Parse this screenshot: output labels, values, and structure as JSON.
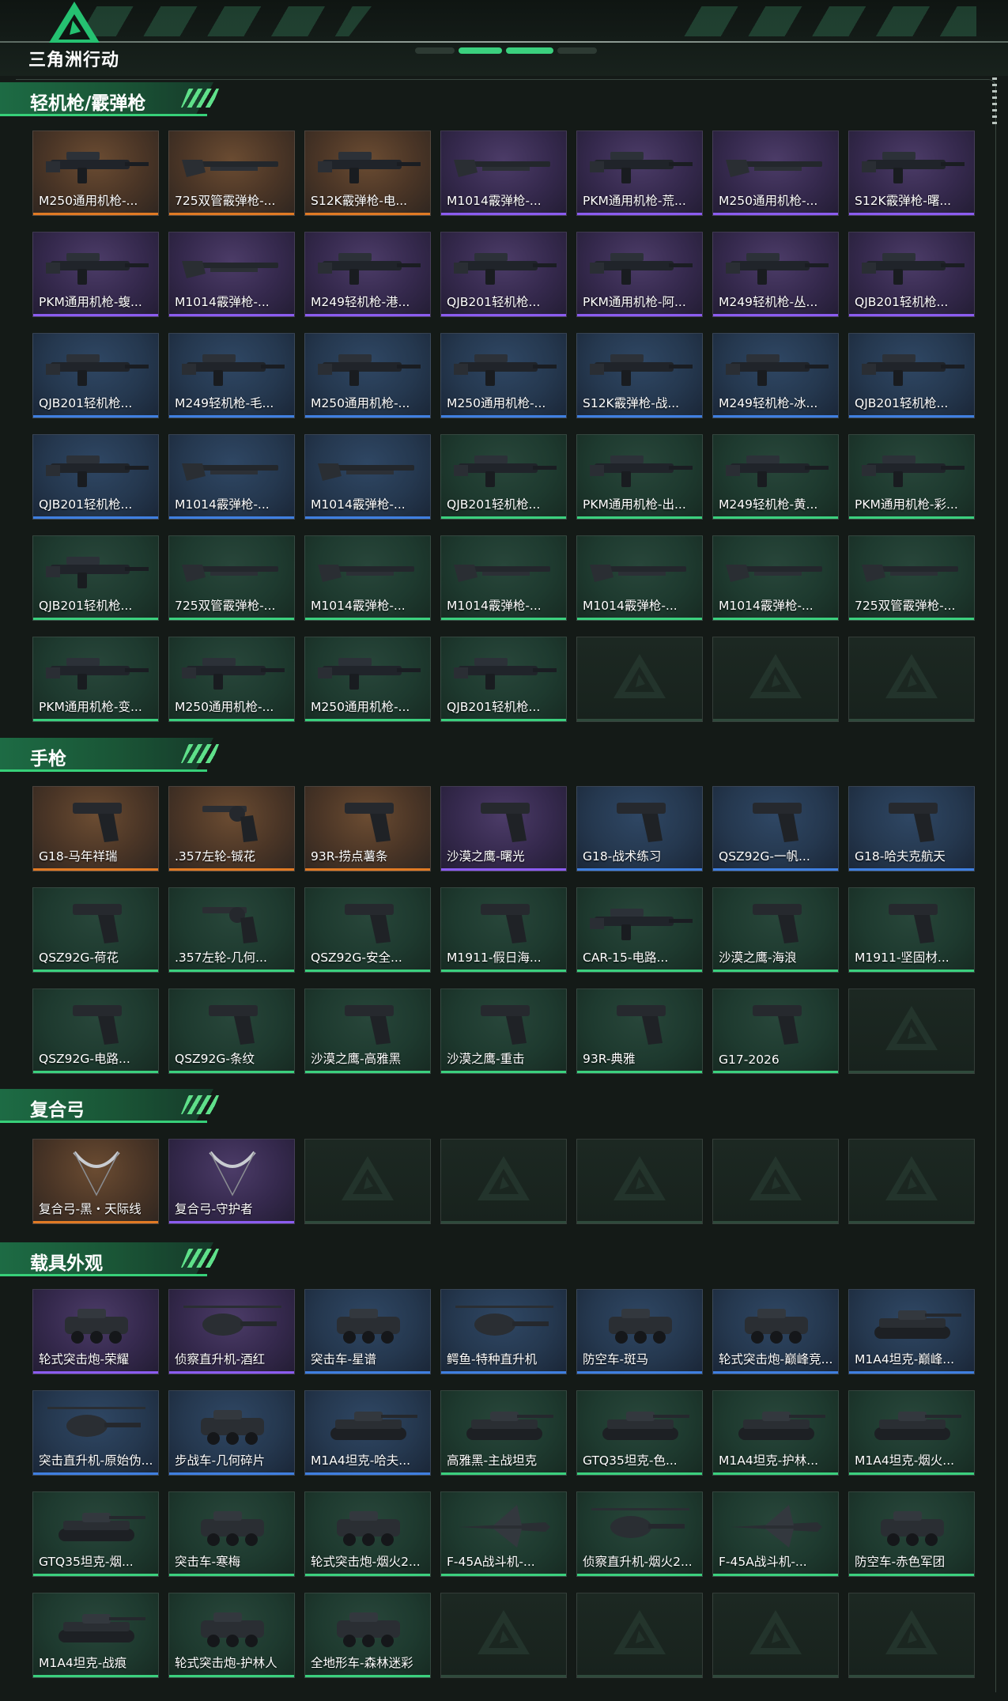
{
  "header": {
    "logo_text": "三角洲行动"
  },
  "colors": {
    "gold": "#e07a24",
    "purple": "#8b5cf0",
    "blue": "#3f7fe0",
    "green": "#3bd07e",
    "accent": "#37d079"
  },
  "sections": [
    {
      "title": "轻机枪/霰弹枪",
      "items": [
        {
          "label": "M250通用机枪-...",
          "q": "gold",
          "icon": "machine-gun"
        },
        {
          "label": "725双管霰弹枪-...",
          "q": "gold",
          "icon": "shotgun"
        },
        {
          "label": "S12K霰弹枪-电...",
          "q": "gold",
          "icon": "machine-gun"
        },
        {
          "label": "M1014霰弹枪-...",
          "q": "purple",
          "icon": "shotgun"
        },
        {
          "label": "PKM通用机枪-荒...",
          "q": "purple",
          "icon": "machine-gun"
        },
        {
          "label": "M250通用机枪-...",
          "q": "purple",
          "icon": "shotgun"
        },
        {
          "label": "S12K霰弹枪-曙...",
          "q": "purple",
          "icon": "machine-gun"
        },
        {
          "label": "PKM通用机枪-蝮...",
          "q": "purple",
          "icon": "machine-gun"
        },
        {
          "label": "M1014霰弹枪-...",
          "q": "purple",
          "icon": "shotgun"
        },
        {
          "label": "M249轻机枪-港...",
          "q": "purple",
          "icon": "machine-gun"
        },
        {
          "label": "QJB201轻机枪...",
          "q": "purple",
          "icon": "machine-gun"
        },
        {
          "label": "PKM通用机枪-阿...",
          "q": "purple",
          "icon": "machine-gun"
        },
        {
          "label": "M249轻机枪-丛...",
          "q": "purple",
          "icon": "machine-gun"
        },
        {
          "label": "QJB201轻机枪...",
          "q": "purple",
          "icon": "machine-gun"
        },
        {
          "label": "QJB201轻机枪...",
          "q": "blue",
          "icon": "machine-gun"
        },
        {
          "label": "M249轻机枪-毛...",
          "q": "blue",
          "icon": "machine-gun"
        },
        {
          "label": "M250通用机枪-...",
          "q": "blue",
          "icon": "machine-gun"
        },
        {
          "label": "M250通用机枪-...",
          "q": "blue",
          "icon": "machine-gun"
        },
        {
          "label": "S12K霰弹枪-战...",
          "q": "blue",
          "icon": "machine-gun"
        },
        {
          "label": "M249轻机枪-冰...",
          "q": "blue",
          "icon": "machine-gun"
        },
        {
          "label": "QJB201轻机枪...",
          "q": "blue",
          "icon": "machine-gun"
        },
        {
          "label": "QJB201轻机枪...",
          "q": "blue",
          "icon": "machine-gun"
        },
        {
          "label": "M1014霰弹枪-...",
          "q": "blue",
          "icon": "shotgun"
        },
        {
          "label": "M1014霰弹枪-...",
          "q": "blue",
          "icon": "shotgun"
        },
        {
          "label": "QJB201轻机枪...",
          "q": "green",
          "icon": "machine-gun"
        },
        {
          "label": "PKM通用机枪-出...",
          "q": "green",
          "icon": "machine-gun"
        },
        {
          "label": "M249轻机枪-黄...",
          "q": "green",
          "icon": "machine-gun"
        },
        {
          "label": "PKM通用机枪-彩...",
          "q": "green",
          "icon": "machine-gun"
        },
        {
          "label": "QJB201轻机枪...",
          "q": "green",
          "icon": "machine-gun"
        },
        {
          "label": "725双管霰弹枪-...",
          "q": "green",
          "icon": "shotgun"
        },
        {
          "label": "M1014霰弹枪-...",
          "q": "green",
          "icon": "shotgun"
        },
        {
          "label": "M1014霰弹枪-...",
          "q": "green",
          "icon": "shotgun"
        },
        {
          "label": "M1014霰弹枪-...",
          "q": "green",
          "icon": "shotgun"
        },
        {
          "label": "M1014霰弹枪-...",
          "q": "green",
          "icon": "shotgun"
        },
        {
          "label": "725双管霰弹枪-...",
          "q": "green",
          "icon": "shotgun"
        },
        {
          "label": "PKM通用机枪-变...",
          "q": "green",
          "icon": "machine-gun"
        },
        {
          "label": "M250通用机枪-...",
          "q": "green",
          "icon": "machine-gun"
        },
        {
          "label": "M250通用机枪-...",
          "q": "green",
          "icon": "machine-gun"
        },
        {
          "label": "QJB201轻机枪...",
          "q": "green",
          "icon": "machine-gun"
        },
        {
          "label": "",
          "q": "empty"
        },
        {
          "label": "",
          "q": "empty"
        },
        {
          "label": "",
          "q": "empty"
        }
      ]
    },
    {
      "title": "手枪",
      "items": [
        {
          "label": "G18-马年祥瑞",
          "q": "gold",
          "icon": "pistol"
        },
        {
          "label": ".357左轮-铖花",
          "q": "gold",
          "icon": "revolver"
        },
        {
          "label": "93R-捞点薯条",
          "q": "gold",
          "icon": "pistol"
        },
        {
          "label": "沙漠之鹰-曙光",
          "q": "purple",
          "icon": "pistol"
        },
        {
          "label": "G18-战术练习",
          "q": "blue",
          "icon": "pistol"
        },
        {
          "label": "QSZ92G-一帆...",
          "q": "blue",
          "icon": "pistol"
        },
        {
          "label": "G18-哈夫克航天",
          "q": "blue",
          "icon": "pistol"
        },
        {
          "label": "QSZ92G-荷花",
          "q": "green",
          "icon": "pistol"
        },
        {
          "label": ".357左轮-几何...",
          "q": "green",
          "icon": "revolver"
        },
        {
          "label": "QSZ92G-安全...",
          "q": "green",
          "icon": "pistol"
        },
        {
          "label": "M1911-假日海...",
          "q": "green",
          "icon": "pistol"
        },
        {
          "label": "CAR-15-电路...",
          "q": "green",
          "icon": "machine-gun"
        },
        {
          "label": "沙漠之鹰-海浪",
          "q": "green",
          "icon": "pistol"
        },
        {
          "label": "M1911-坚固材...",
          "q": "green",
          "icon": "pistol"
        },
        {
          "label": "QSZ92G-电路...",
          "q": "green",
          "icon": "pistol"
        },
        {
          "label": "QSZ92G-条纹",
          "q": "green",
          "icon": "pistol"
        },
        {
          "label": "沙漠之鹰-高雅黑",
          "q": "green",
          "icon": "pistol"
        },
        {
          "label": "沙漠之鹰-重击",
          "q": "green",
          "icon": "pistol"
        },
        {
          "label": "93R-典雅",
          "q": "green",
          "icon": "pistol"
        },
        {
          "label": "G17-2026",
          "q": "green",
          "icon": "pistol"
        },
        {
          "label": "",
          "q": "empty"
        }
      ]
    },
    {
      "title": "复合弓",
      "items": [
        {
          "label": "复合弓-黑・天际线",
          "q": "gold",
          "icon": "bow"
        },
        {
          "label": "复合弓-守护者",
          "q": "purple",
          "icon": "bow"
        },
        {
          "label": "",
          "q": "empty"
        },
        {
          "label": "",
          "q": "empty"
        },
        {
          "label": "",
          "q": "empty"
        },
        {
          "label": "",
          "q": "empty"
        },
        {
          "label": "",
          "q": "empty"
        }
      ]
    },
    {
      "title": "载具外观",
      "items": [
        {
          "label": "轮式突击炮-荣耀",
          "q": "purple",
          "icon": "vehicle"
        },
        {
          "label": "侦察直升机-酒红",
          "q": "purple",
          "icon": "helicopter"
        },
        {
          "label": "突击车-星谱",
          "q": "blue",
          "icon": "vehicle"
        },
        {
          "label": "鳄鱼-特种直升机",
          "q": "blue",
          "icon": "helicopter"
        },
        {
          "label": "防空车-斑马",
          "q": "blue",
          "icon": "vehicle"
        },
        {
          "label": "轮式突击炮-巅峰竞...",
          "q": "blue",
          "icon": "vehicle"
        },
        {
          "label": "M1A4坦克-巅峰...",
          "q": "blue",
          "icon": "tank"
        },
        {
          "label": "突击直升机-原始伪...",
          "q": "blue",
          "icon": "helicopter"
        },
        {
          "label": "步战车-几何碎片",
          "q": "blue",
          "icon": "vehicle"
        },
        {
          "label": "M1A4坦克-哈夫...",
          "q": "blue",
          "icon": "tank"
        },
        {
          "label": "高雅黑-主战坦克",
          "q": "green",
          "icon": "tank"
        },
        {
          "label": "GTQ35坦克-色...",
          "q": "green",
          "icon": "tank"
        },
        {
          "label": "M1A4坦克-护林...",
          "q": "green",
          "icon": "tank"
        },
        {
          "label": "M1A4坦克-烟火...",
          "q": "green",
          "icon": "tank"
        },
        {
          "label": "GTQ35坦克-烟...",
          "q": "green",
          "icon": "tank"
        },
        {
          "label": "突击车-寒梅",
          "q": "green",
          "icon": "vehicle"
        },
        {
          "label": "轮式突击炮-烟火2...",
          "q": "green",
          "icon": "vehicle"
        },
        {
          "label": "F-45A战斗机-...",
          "q": "green",
          "icon": "jet"
        },
        {
          "label": "侦察直升机-烟火2...",
          "q": "green",
          "icon": "helicopter"
        },
        {
          "label": "F-45A战斗机-...",
          "q": "green",
          "icon": "jet"
        },
        {
          "label": "防空车-赤色军团",
          "q": "green",
          "icon": "vehicle"
        },
        {
          "label": "M1A4坦克-战痕",
          "q": "green",
          "icon": "tank"
        },
        {
          "label": "轮式突击炮-护林人",
          "q": "green",
          "icon": "vehicle"
        },
        {
          "label": "全地形车-森林迷彩",
          "q": "green",
          "icon": "vehicle"
        },
        {
          "label": "",
          "q": "empty"
        },
        {
          "label": "",
          "q": "empty"
        },
        {
          "label": "",
          "q": "empty"
        },
        {
          "label": "",
          "q": "empty"
        }
      ]
    }
  ]
}
